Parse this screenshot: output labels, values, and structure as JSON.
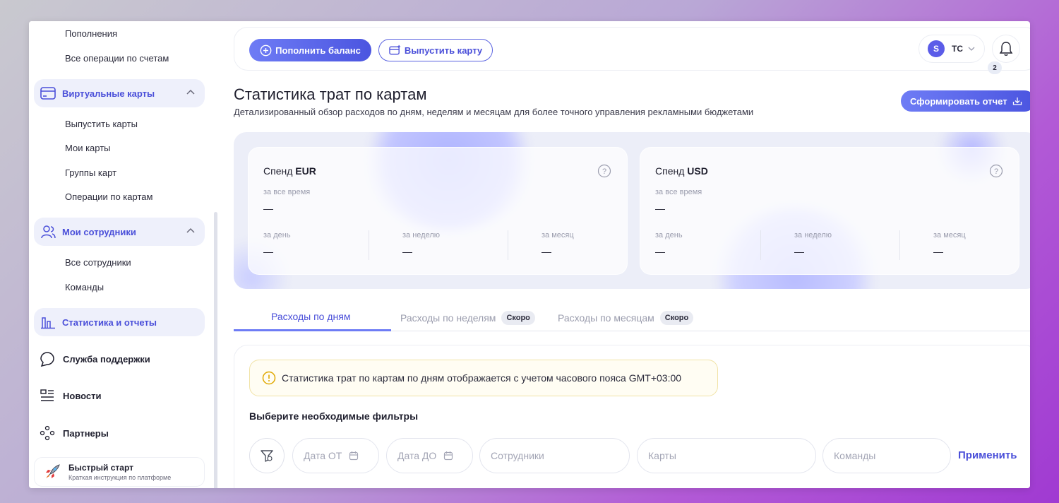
{
  "sidebar": {
    "replenishment_label": "Пополнения",
    "all_account_ops_label": "Все операции по счетам",
    "virtual_cards": {
      "label": "Виртуальные карты",
      "items": [
        "Выпустить карты",
        "Мои карты",
        "Группы карт",
        "Операции по картам"
      ]
    },
    "employees": {
      "label": "Мои сотрудники",
      "items": [
        "Все сотрудники",
        "Команды"
      ]
    },
    "stats_label": "Статистика и отчеты",
    "support_label": "Служба поддержки",
    "news_label": "Новости",
    "partners_label": "Партнеры",
    "quick_start": {
      "title": "Быстрый старт",
      "subtitle": "Краткая инструкция по платформе"
    }
  },
  "topbar": {
    "topup_label": "Пополнить баланс",
    "issue_card_label": "Выпустить карту",
    "avatar_letter": "S",
    "user_initials": "TC",
    "notifications_count": "2"
  },
  "page": {
    "title": "Статистика трат по картам",
    "subtitle": "Детализированный обзор расходов по дням, неделям и месяцам для более точного управления рекламными бюджетами",
    "report_button": "Сформировать отчет"
  },
  "stats": {
    "cards": [
      {
        "title_prefix": "Спенд",
        "currency": "EUR",
        "all_time_label": "за все время",
        "all_time_value": "—",
        "day_label": "за день",
        "day_value": "—",
        "week_label": "за неделю",
        "week_value": "—",
        "month_label": "за месяц",
        "month_value": "—"
      },
      {
        "title_prefix": "Спенд",
        "currency": "USD",
        "all_time_label": "за все время",
        "all_time_value": "—",
        "day_label": "за день",
        "day_value": "—",
        "week_label": "за неделю",
        "week_value": "—",
        "month_label": "за месяц",
        "month_value": "—"
      }
    ]
  },
  "tabs": {
    "daily": "Расходы по дням",
    "weekly": "Расходы по неделям",
    "monthly": "Расходы по месяцам",
    "soon_badge": "Скоро"
  },
  "filters": {
    "notice": "Статистика трат по картам по дням отображается с учетом часового пояса GMT+03:00",
    "title": "Выберите необходимые фильтры",
    "date_from": "Дата ОТ",
    "date_to": "Дата ДО",
    "employees": "Сотрудники",
    "cards": "Карты",
    "teams": "Команды",
    "apply": "Применить"
  },
  "colors": {
    "accent": "#4a4fd9",
    "accent_gradient_start": "#6e7cf5",
    "sidebar_active_bg": "#eef0fb",
    "stats_panel_bg": "#eceef8",
    "notice_bg": "#fffdf3"
  }
}
